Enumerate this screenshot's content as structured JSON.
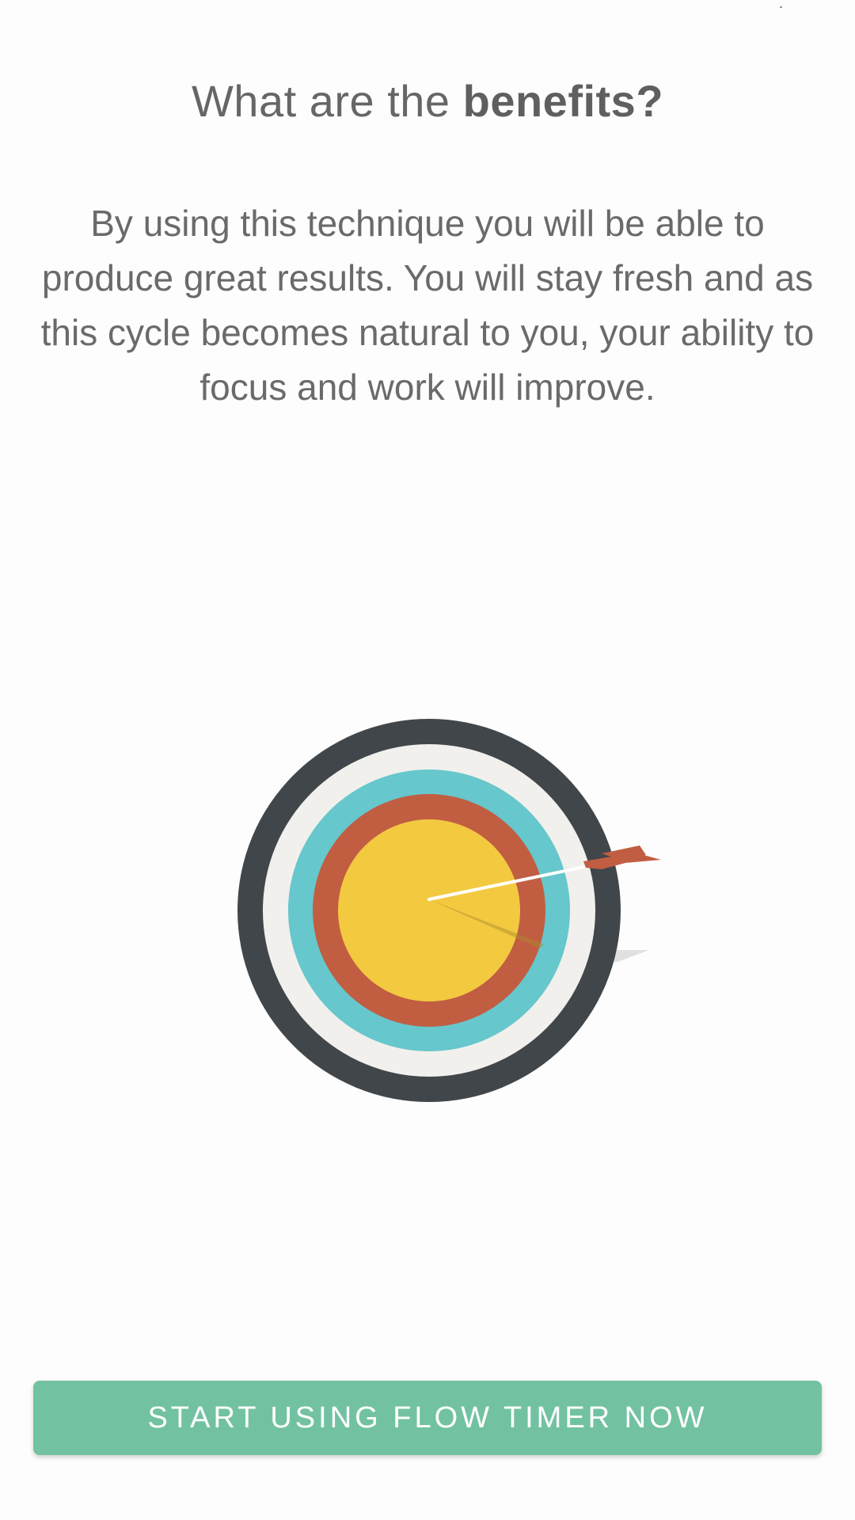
{
  "headline": {
    "prefix": "What are the ",
    "emphasis": "benefits?"
  },
  "body": {
    "text": "By using this technique you will be able to produce great results. You will stay fresh and as this cycle becomes natural to you, your ability to focus and work will improve."
  },
  "illustration": {
    "icon": "target-with-arrow-icon",
    "colors": {
      "outer_ring": "#41464a",
      "white_ring": "#f1f0ec",
      "teal_ring": "#66c7cc",
      "red_ring": "#c15e42",
      "bullseye": "#f3c940",
      "arrow_fletching": "#c15e42",
      "arrow_shaft": "#ffffff"
    }
  },
  "cta": {
    "label": "START USING FLOW TIMER NOW",
    "color": "#72c2a1"
  }
}
